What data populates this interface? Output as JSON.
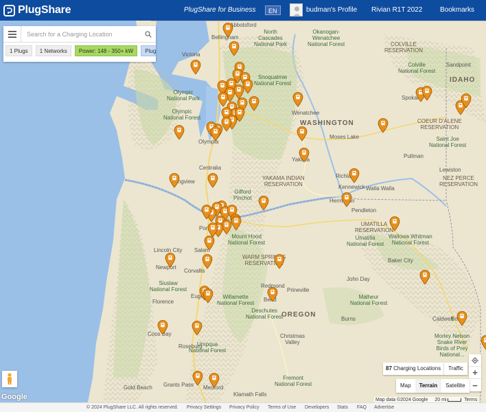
{
  "header": {
    "logo_text": "PlugShare",
    "business_link": "PlugShare for Business",
    "language": "EN",
    "profile": "budman's Profile",
    "vehicle": "Rivian R1T 2022",
    "bookmarks": "Bookmarks"
  },
  "search": {
    "placeholder": "Search for a Charging Location",
    "filters": {
      "plugs": "1 Plugs",
      "networks": "1 Networks",
      "power": "Power: 148 - 350+ kW",
      "score": "PlugScore"
    }
  },
  "map": {
    "labels": {
      "abbotsford": "Abbotsford",
      "bellingham": "Bellingham",
      "north_cascades": "North\nCascades\nNational Park",
      "okanogan": "Okanogan-\nWenatchee\nNational Forest",
      "colville_res": "COLVILLE\nRESERVATION",
      "colville_nf": "Colville\nNational Forest",
      "sandpoint": "Sandpoint",
      "idaho": "IDAHO",
      "victoria": "Victoria",
      "snoqualmie": "Snoqualmie\nNational Forest",
      "olympic": "Olympic\nNational Park",
      "olympic_nf": "Olympic\nNational Forest",
      "wenatchee": "Wenatchee",
      "spokane": "Spokane",
      "coeur_alene": "COEUR D'ALENE\nRESERVATION",
      "saint_joe": "Saint Joe\nNational Forest",
      "washington": "WASHINGTON",
      "moses_lake": "Moses Lake",
      "olympia": "Olympia",
      "yakima": "Yakima",
      "pullman": "Pullman",
      "lewiston": "Lewiston",
      "nez_perce": "NEZ PERCE\nRESERVATION",
      "centralia": "Centralia",
      "yakama_res": "YAKAMA INDIAN\nRESERVATION",
      "richland": "Richland",
      "kennewick": "Kennewick",
      "walla_walla": "Walla Walla",
      "hermiston": "Hermiston",
      "pendleton": "Pendleton",
      "longview": "Longview",
      "gifford": "Gifford\nPinchot",
      "portland": "Portland",
      "umatilla_res": "UMATILLA\nRESERVATION",
      "umatilla_nf": "Umatilla\nNational Forest",
      "wallowa": "Wallowa Whitman\nNational Forest",
      "mount_hood": "Mount Hood\nNational Forest",
      "salem": "Salem",
      "lincoln_city": "Lincoln City",
      "warm_springs": "WARM SPRINGS\nRESERVATION",
      "newport": "Newport",
      "baker_city": "Baker City",
      "corvallis": "Corvallis",
      "john_day": "John Day",
      "siuslaw": "Siuslaw\nNational Forest",
      "redmond": "Redmond",
      "prineville": "Prineville",
      "eugene": "Eugene",
      "willamette": "Willamette\nNational Forest",
      "malheur": "Malheur\nNational Forest",
      "florence": "Florence",
      "bend": "Bend",
      "deschutes": "Deschutes\nNational Forest",
      "oregon": "OREGON",
      "burns": "Burns",
      "caldwell": "Caldwell",
      "coos_bay": "Coos Bay",
      "roseburg": "Roseburg",
      "umpqua": "Umpqua\nNational Forest",
      "christmas_valley": "Christmas\nValley",
      "morley_nelson": "Morley Nelson\nSnake River\nBirds of Prey\nNational...",
      "boise": "Boise",
      "grants_pass": "Grants Pass",
      "medford": "Medford",
      "gold_beach": "Gold Beach",
      "fremont": "Fremont\nNational Forest",
      "klamath": "Klamath Falls"
    },
    "location_count": "87",
    "location_count_label": "Charging Locations",
    "traffic": "Traffic",
    "map_types": [
      "Map",
      "Terrain",
      "Satellite"
    ],
    "active_map_type": "Terrain",
    "google_logo": "Google",
    "attribution": "Map data ©2024 Google",
    "scale": "20 mi",
    "terms": "Terms",
    "pin_color": "#e8901c",
    "pin_count": 63
  },
  "footer": {
    "copyright": "© 2024 PlugShare LLC. All rights reserved.",
    "links": [
      "Privacy Settings",
      "Privacy Policy",
      "Terms of Use",
      "Developers",
      "Stats",
      "FAQ",
      "Advertise"
    ]
  }
}
